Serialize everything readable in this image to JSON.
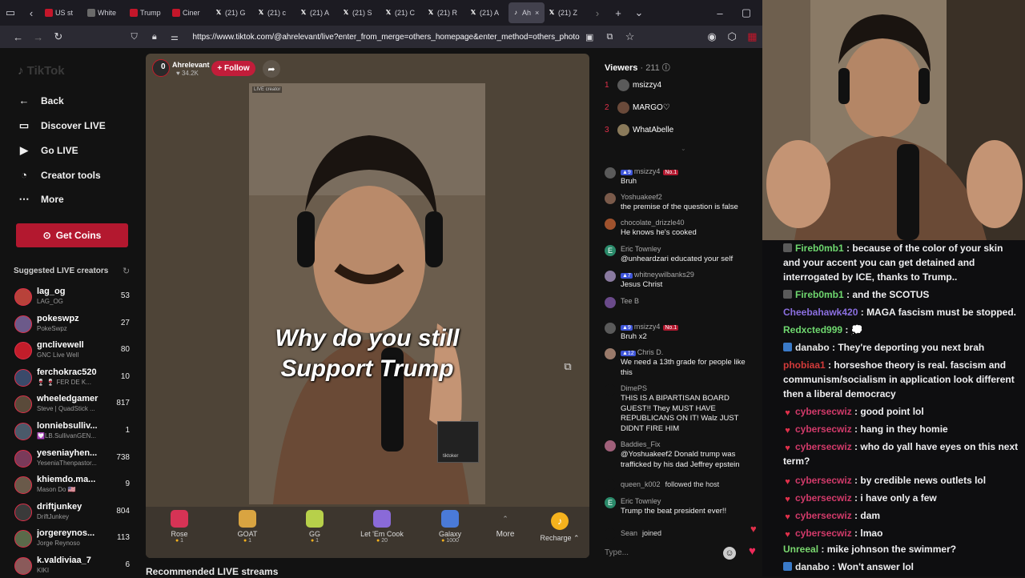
{
  "browser": {
    "tabs": [
      {
        "label": "US st",
        "fav": "#c4162a"
      },
      {
        "label": "White",
        "fav": "#6a6a6a"
      },
      {
        "label": "Trump",
        "fav": "#c4162a"
      },
      {
        "label": "Ciner",
        "fav": "#c4162a"
      },
      {
        "label": "(21) G",
        "fav": "x"
      },
      {
        "label": "(21) c",
        "fav": "x"
      },
      {
        "label": "(21) A",
        "fav": "x"
      },
      {
        "label": "(21) S",
        "fav": "x"
      },
      {
        "label": "(21) C",
        "fav": "x"
      },
      {
        "label": "(21) R",
        "fav": "x"
      },
      {
        "label": "(21) A",
        "fav": "x"
      },
      {
        "label": "Ah",
        "fav": "tiktok",
        "active": true
      },
      {
        "label": "(21) Z",
        "fav": "x"
      }
    ],
    "url": "https://www.tiktok.com/@ahrelevant/live?enter_from_merge=others_homepage&enter_method=others_photo"
  },
  "sidebar": {
    "logo": "TikTok",
    "items": [
      {
        "label": "Back",
        "icon": "arrow-left-icon"
      },
      {
        "label": "Discover LIVE",
        "icon": "tv-icon"
      },
      {
        "label": "Go LIVE",
        "icon": "camera-icon"
      },
      {
        "label": "Creator tools",
        "icon": "lightbulb-icon"
      },
      {
        "label": "More",
        "icon": "more-icon"
      }
    ],
    "get_coins": "Get Coins",
    "suggested_title": "Suggested LIVE creators",
    "creators": [
      {
        "name": "lag_og",
        "sub": "LAG_OG",
        "count": "53",
        "color": "#b8423a"
      },
      {
        "name": "pokeswpz",
        "sub": "PokeSwpz",
        "count": "27",
        "color": "#6c5a8a"
      },
      {
        "name": "gnclivewell",
        "sub": "GNC Live Well",
        "count": "80",
        "color": "#c21d2a"
      },
      {
        "name": "ferchokrac520",
        "sub": "🍷 🍷 FER DE K...",
        "count": "10",
        "color": "#3a4a6a"
      },
      {
        "name": "wheeledgamer",
        "sub": "Steve | QuadStick ...",
        "count": "817",
        "color": "#5a4a3a"
      },
      {
        "name": "lonniebsulliv...",
        "sub": "💟LB.SullivanGEN...",
        "count": "1",
        "color": "#4a5a6a"
      },
      {
        "name": "yeseniayhen...",
        "sub": "YeseniaThenpastor...",
        "count": "738",
        "color": "#7a3a5a"
      },
      {
        "name": "khiemdo.ma...",
        "sub": "Mason Do 🇺🇸",
        "count": "9",
        "color": "#6a5a4a"
      },
      {
        "name": "driftjunkey",
        "sub": "DriftJunkey",
        "count": "804",
        "color": "#3a3a3a"
      },
      {
        "name": "jorgereynos...",
        "sub": "Jorge Reynoso",
        "count": "113",
        "color": "#5a6a4a"
      },
      {
        "name": "k.valdiviaa_7",
        "sub": "KIKI",
        "count": "6",
        "color": "#8a5a5a"
      }
    ]
  },
  "host": {
    "name": "Ahrelevant",
    "likes": "34.2K",
    "count": "0",
    "follow": "+ Follow"
  },
  "video": {
    "badge": "LIVE creator",
    "caption_1": "Why do you  still",
    "caption_2": "Support Trump",
    "overlay_label": "tiktoker"
  },
  "gifts": [
    {
      "name": "Rose",
      "cost": "1",
      "color": "#d63355"
    },
    {
      "name": "GOAT",
      "cost": "1",
      "color": "#d9a441"
    },
    {
      "name": "GG",
      "cost": "1",
      "color": "#b7d04a"
    },
    {
      "name": "Let 'Em Cook",
      "cost": "20",
      "color": "#8a6ad8"
    },
    {
      "name": "Galaxy",
      "cost": "1000",
      "color": "#4a7ad8"
    }
  ],
  "gift_more": "More",
  "recharge": "Recharge",
  "recommended": "Recommended LIVE streams",
  "viewers": {
    "title": "Viewers",
    "count": "211",
    "top": [
      {
        "rank": "1",
        "name": "msizzy4",
        "color": "#5a5a5a"
      },
      {
        "rank": "2",
        "name": "MARGO♡",
        "color": "#6a4a3a"
      },
      {
        "rank": "3",
        "name": "WhatAbelle",
        "color": "#8a7a5a"
      }
    ]
  },
  "chat": [
    {
      "user": "msizzy4",
      "lvl": "9",
      "no1": "No.1",
      "text": "Bruh",
      "color": "#5a5a5a"
    },
    {
      "user": "Yoshuakeef2",
      "text": "the premise of the question is false",
      "color": "#7a5a4a"
    },
    {
      "user": "chocolate_drizzle40",
      "text": "He knows he's cooked",
      "color": "#a0522d"
    },
    {
      "user": "Eric Townley",
      "text": "@unheardzari educated your self",
      "color": "#2a8a6a",
      "letter": "E"
    },
    {
      "user": "whitneywilbanks29",
      "lvl": "7",
      "text": "Jesus Christ",
      "color": "#8a7aa0"
    },
    {
      "user": "Tee B",
      "text": "",
      "color": "#6a4a8a"
    },
    {
      "user": "msizzy4",
      "lvl": "9",
      "no1": "No.1",
      "text": "Bruh x2",
      "color": "#5a5a5a"
    },
    {
      "user": "Chris D.",
      "lvl": "12",
      "text": "We need a 13th grade for people like this",
      "color": "#9a7a6a"
    },
    {
      "user": "DimePS",
      "text": "THIS IS A BIPARTISAN BOARD GUEST!! They MUST HAVE REPUBLICANS ON IT! Walz JUST DIDNT FIRE HIM",
      "color": "#121212"
    },
    {
      "user": "Baddies_Fix",
      "text": "@Yoshuakeef2 Donald trump was trafficked by his dad Jeffrey epstein",
      "color": "#a0607a"
    },
    {
      "user": "queen_k002",
      "text": "followed the host",
      "color": "#121212"
    },
    {
      "user": "Eric Townley",
      "text": "Trump the beat president ever!!",
      "color": "#2a8a6a",
      "letter": "E"
    },
    {
      "user": "Sean",
      "text": "joined",
      "color": "#121212"
    }
  ],
  "chat_input": {
    "placeholder": "Type..."
  },
  "twitch": [
    {
      "user": "Fireb0mb1",
      "color": "#6fd86f",
      "pre": "#5a5a5a",
      "text": "because of the color of your skin and your accent you can get detained and interrogated by ICE, thanks to Trump.."
    },
    {
      "user": "Fireb0mb1",
      "color": "#6fd86f",
      "pre": "#5a5a5a",
      "text": "and the SCOTUS"
    },
    {
      "user": "Cheebahawk420",
      "color": "#8b6fe0",
      "text": "MAGA fascism must be stopped."
    },
    {
      "user": "Redxcted999",
      "color": "#6fd86f",
      "text": "💭"
    },
    {
      "user": "danabo",
      "color": "#e8e8e8",
      "pre": "#3a7ac8",
      "text": "They're deporting you next brah"
    },
    {
      "user": "phobiaa1",
      "color": "#d23a3a",
      "text": "horseshoe theory is real. fascism and communism/socialism in application look different then a liberal democracy"
    },
    {
      "user": "cybersecwiz",
      "color": "#d23a6a",
      "heart": true,
      "text": "good point lol"
    },
    {
      "user": "cybersecwiz",
      "color": "#d23a6a",
      "heart": true,
      "text": "hang in they homie"
    },
    {
      "user": "cybersecwiz",
      "color": "#d23a6a",
      "heart": true,
      "text": "who do yall have eyes on this next term?"
    },
    {
      "user": "cybersecwiz",
      "color": "#d23a6a",
      "heart": true,
      "text": "by credible news outlets lol"
    },
    {
      "user": "cybersecwiz",
      "color": "#d23a6a",
      "heart": true,
      "text": "i have only a few"
    },
    {
      "user": "cybersecwiz",
      "color": "#d23a6a",
      "heart": true,
      "text": "dam"
    },
    {
      "user": "cybersecwiz",
      "color": "#d23a6a",
      "heart": true,
      "text": "lmao"
    },
    {
      "user": "Unreeal",
      "color": "#7ad86f",
      "text": "mike johnson the swimmer?"
    },
    {
      "user": "danabo",
      "color": "#e8e8e8",
      "pre": "#3a7ac8",
      "text": "Won't answer lol"
    }
  ]
}
